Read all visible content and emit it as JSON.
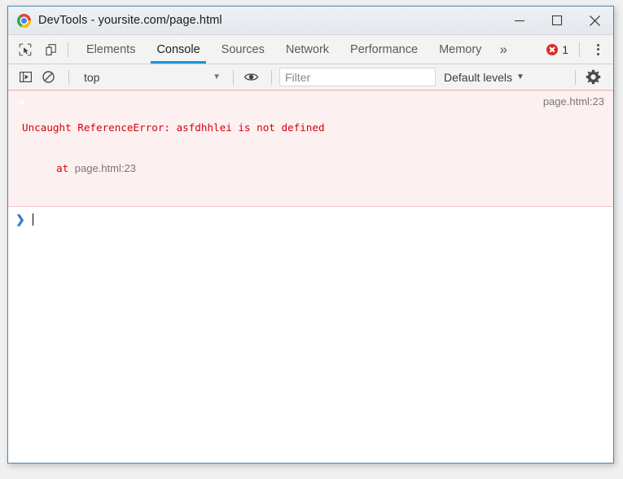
{
  "window": {
    "title": "DevTools - yoursite.com/page.html",
    "logo_icon": "chrome-logo-icon",
    "controls": {
      "minimize": "minimize-icon",
      "maximize": "maximize-icon",
      "close": "close-icon"
    }
  },
  "tabbar": {
    "inspect_icon": "inspect-element-icon",
    "device_icon": "device-toolbar-icon",
    "tabs": [
      {
        "label": "Elements",
        "active": false
      },
      {
        "label": "Console",
        "active": true
      },
      {
        "label": "Sources",
        "active": false
      },
      {
        "label": "Network",
        "active": false
      },
      {
        "label": "Performance",
        "active": false
      },
      {
        "label": "Memory",
        "active": false
      }
    ],
    "overflow_label": "»",
    "error_count": "1",
    "error_icon": "error-circle-icon",
    "menu_icon": "more-vertical-icon"
  },
  "console_toolbar": {
    "sidebar_icon": "console-sidebar-icon",
    "clear_icon": "clear-console-icon",
    "context": "top",
    "context_caret": "▼",
    "eye_icon": "eye-icon",
    "filter_placeholder": "Filter",
    "filter_value": "",
    "levels_label": "Default levels",
    "levels_caret": "▼",
    "settings_icon": "gear-icon"
  },
  "console": {
    "messages": [
      {
        "icon": "error-circle-icon",
        "line1": "Uncaught ReferenceError: asfdhhlei is not defined",
        "at_keyword": "at",
        "at_source": "page.html:23",
        "source_link": "page.html:23"
      }
    ],
    "prompt_chevron": "❯",
    "prompt_value": ""
  },
  "colors": {
    "accent": "#1a96d8",
    "error": "#d93025",
    "error_text": "#d8000c",
    "error_bg": "#fdf0f0",
    "prompt": "#3b78c8"
  }
}
